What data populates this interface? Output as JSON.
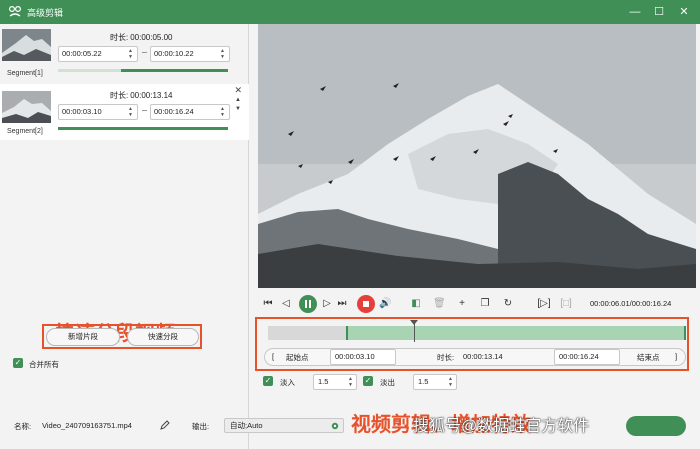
{
  "app": {
    "title": "高级剪辑"
  },
  "window": {
    "minimize": "—",
    "maximize": "☐",
    "close": "✕"
  },
  "segments": [
    {
      "label": "Segment[1]",
      "duration_label": "时长:",
      "duration": "00:00:05.00",
      "start": "00:00:05.22",
      "end": "00:00:10.22"
    },
    {
      "label": "Segment[2]",
      "duration_label": "时长:",
      "duration": "00:00:13.14",
      "start": "00:00:03.10",
      "end": "00:00:16.24"
    }
  ],
  "annotations": {
    "left": "快速分段视频",
    "right": "视频剪辑、增加特效",
    "watermark": "搜狐号@数据蛙官方软件"
  },
  "left_buttons": {
    "new_segment": "新增片段",
    "quick_split": "快速分段"
  },
  "merge": {
    "label": "合并所有",
    "checked": true
  },
  "bottom": {
    "name_label": "名称:",
    "file_name": "Video_240709163751.mp4",
    "output_label": "输出:",
    "output_value": "自动;Auto"
  },
  "player": {
    "time": "00:00:06.01/00:00:16.24",
    "start_label": "起始点",
    "start_value": "00:00:03.10",
    "duration_label": "时长:",
    "duration_value": "00:00:13.14",
    "end_value": "00:00:16.24",
    "end_label": "结束点",
    "fade_in_label": "淡入",
    "fade_in_value": "1.5",
    "fade_out_label": "淡出",
    "fade_out_value": "1.5"
  },
  "colors": {
    "brand": "#3f8f56",
    "annotation": "#e8512a"
  }
}
